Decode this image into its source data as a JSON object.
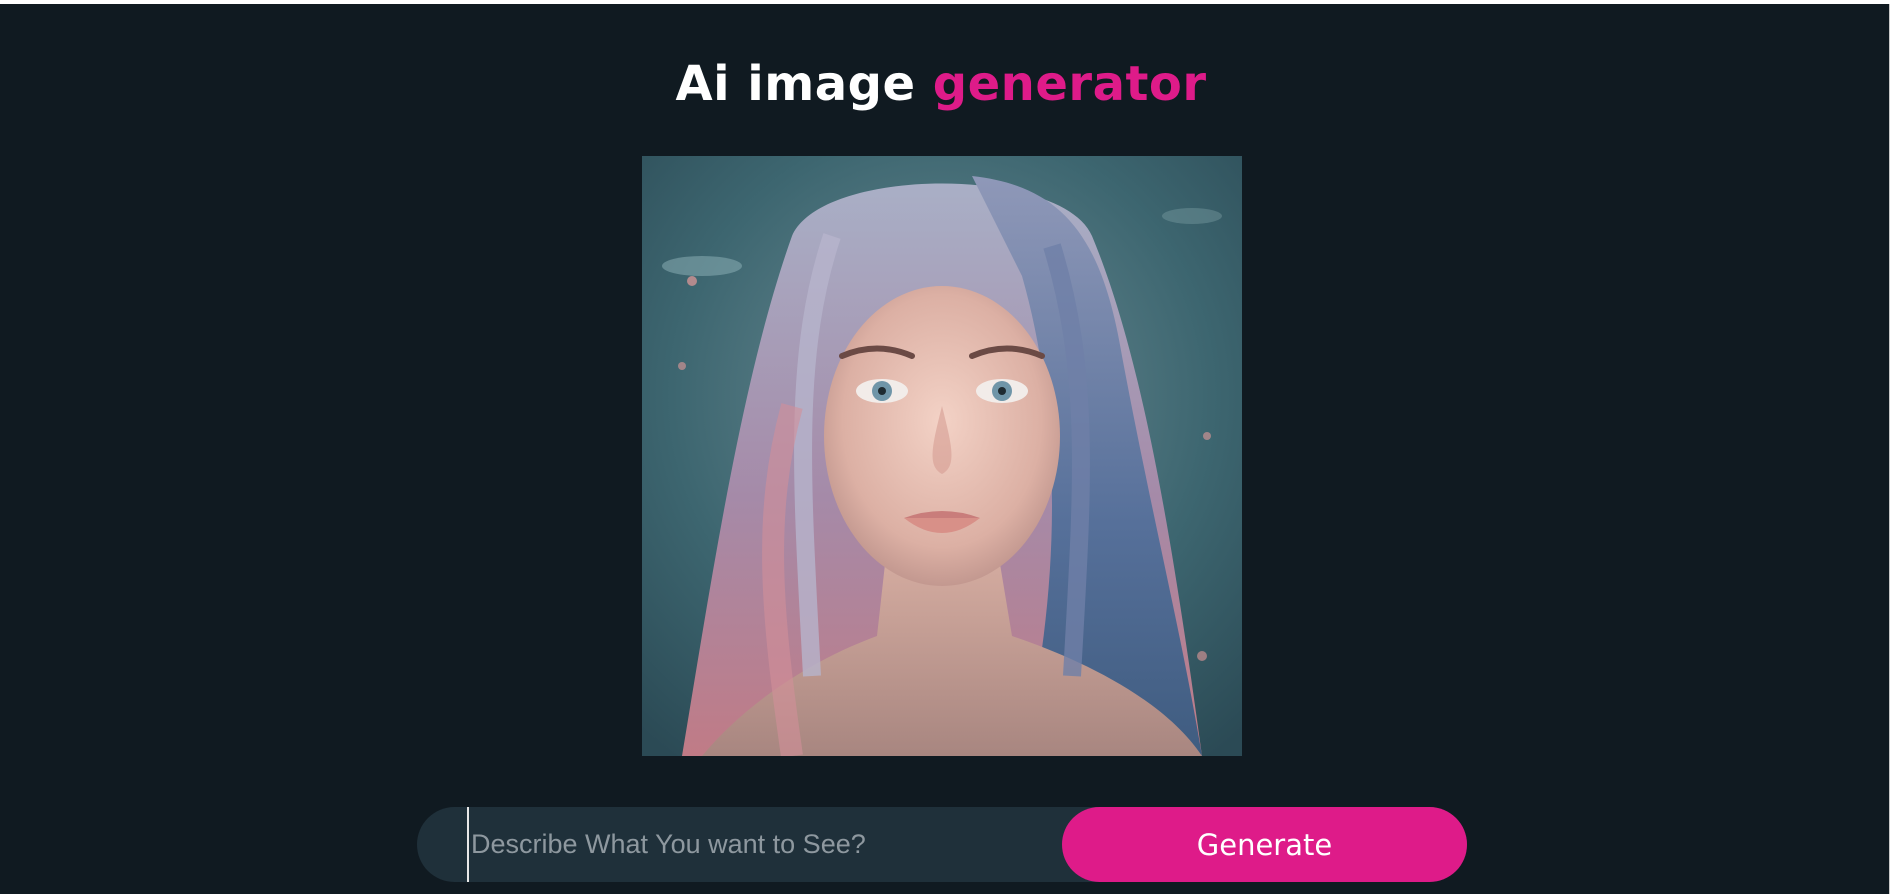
{
  "header": {
    "title_main": "Ai image",
    "title_accent": "generator"
  },
  "colors": {
    "background": "#101a21",
    "accent": "#de1b89",
    "input_bg": "#1f303a"
  },
  "preview": {
    "icon": "generated-image-portrait"
  },
  "prompt": {
    "value": "",
    "placeholder": "Describe What You want to See?"
  },
  "actions": {
    "generate_label": "Generate"
  }
}
